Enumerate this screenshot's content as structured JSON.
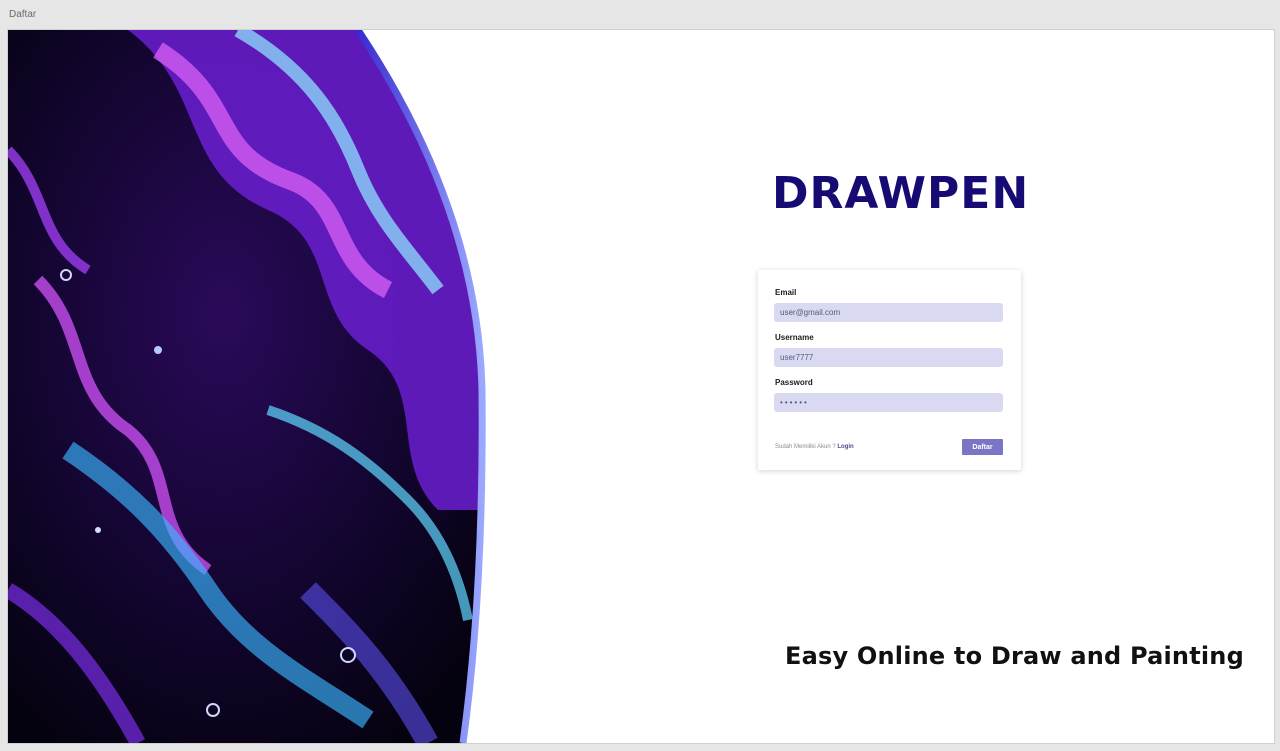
{
  "window": {
    "title": "Daftar"
  },
  "brand": {
    "name": "DRAWPEN",
    "color": "#160b73"
  },
  "form": {
    "email_label": "Email",
    "email_value": "user@gmail.com",
    "username_label": "Username",
    "username_value": "user7777",
    "password_label": "Password",
    "password_value": "••••••",
    "have_account_text": "Sudah Memiliki Akun ? ",
    "login_link": "Login",
    "submit_label": "Daftar",
    "field_color": "#d9daf2",
    "button_color": "#7b75c6"
  },
  "tagline": "Easy Online to Draw and Painting",
  "art": {
    "description_icon": "fluid-art-image"
  }
}
